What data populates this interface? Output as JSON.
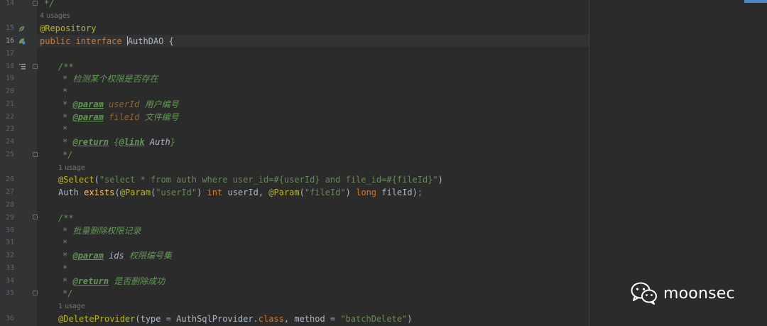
{
  "gutter": {
    "line_numbers": [
      "14",
      "15",
      "16",
      "17",
      "18",
      "19",
      "20",
      "21",
      "22",
      "23",
      "24",
      "25",
      "26",
      "27",
      "28",
      "29",
      "30",
      "31",
      "32",
      "33",
      "34",
      "35",
      "36"
    ],
    "current_line": "16"
  },
  "hints": {
    "usage_4": "4 usages",
    "usage_1a": "1 usage",
    "usage_1b": "1 usage"
  },
  "code": {
    "l14": "*/",
    "l15_ann": "@Repository",
    "l16_kw": "public interface ",
    "l16_name": "AuthDAO",
    "l16_rest": " {",
    "doc_open": "/**",
    "doc_close": "*/",
    "doc_star": "*",
    "l19_text": " 检测某个权限是否存在",
    "tag_param": "@param",
    "tag_return": "@return",
    "tag_link": "@link",
    "l21_param": "userId",
    "l21_text": " 用户编号",
    "l22_param": "fileId",
    "l22_text": " 文件编号",
    "l24_link_open": "{",
    "l24_link_type": " Auth",
    "l24_link_close": "}",
    "l26_ann": "@Select",
    "l26_open": "(",
    "l26_str": "\"select * from auth where user_id=#{userId} and file_id=#{fileId}\"",
    "l26_close": ")",
    "l27_type": "Auth ",
    "l27_fn": "exists",
    "l27_p1": "(",
    "l27_ann1": "@Param",
    "l27_s1": "\"userId\"",
    "l27_kw1": "int",
    "l27_v1": " userId, ",
    "l27_ann2": "@Param",
    "l27_s2": "\"fileId\"",
    "l27_kw2": "long",
    "l27_v2": " fileId)",
    "l27_semi": ";",
    "l30_text": " 批量删除权限记录",
    "l32_param": "ids",
    "l32_text": " 权限编号集",
    "l34_text": " 是否删除成功",
    "l36_ann": "@DeleteProvider",
    "l36_a": "(type = AuthSqlProvider.",
    "l36_kw": "class",
    "l36_b": ", method = ",
    "l36_str": "\"batchDelete\"",
    "l36_c": ")"
  },
  "watermark": {
    "text": "moonsec",
    "icon": "wechat-icon"
  },
  "colors": {
    "background": "#2b2b2b",
    "keyword": "#cc7832",
    "annotation": "#bbb529",
    "doc_comment": "#629755",
    "string": "#6a8759",
    "method": "#ffc66d"
  }
}
